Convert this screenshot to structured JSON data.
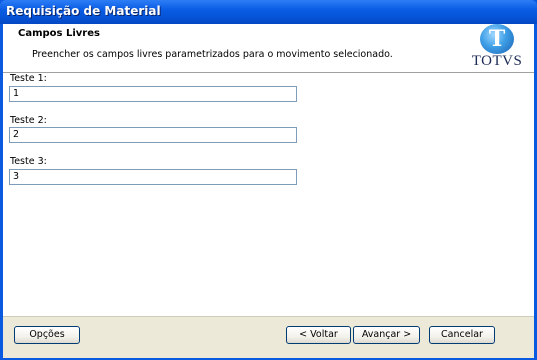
{
  "window": {
    "title": "Requisição de Material"
  },
  "header": {
    "title": "Campos Livres",
    "subtitle": "Preencher os campos livres parametrizados para o movimento selecionado.",
    "logo_text": "TOTVS"
  },
  "fields": [
    {
      "label": "Teste 1:",
      "value": "1"
    },
    {
      "label": "Teste 2:",
      "value": "2"
    },
    {
      "label": "Teste 3:",
      "value": "3"
    }
  ],
  "footer": {
    "options_label": "Opções",
    "back_label": "< Voltar",
    "next_label": "Avançar >",
    "cancel_label": "Cancelar"
  },
  "colors": {
    "titlebar": "#0a5de4",
    "footer_bg": "#ece9d8",
    "input_border": "#7f9db9"
  }
}
